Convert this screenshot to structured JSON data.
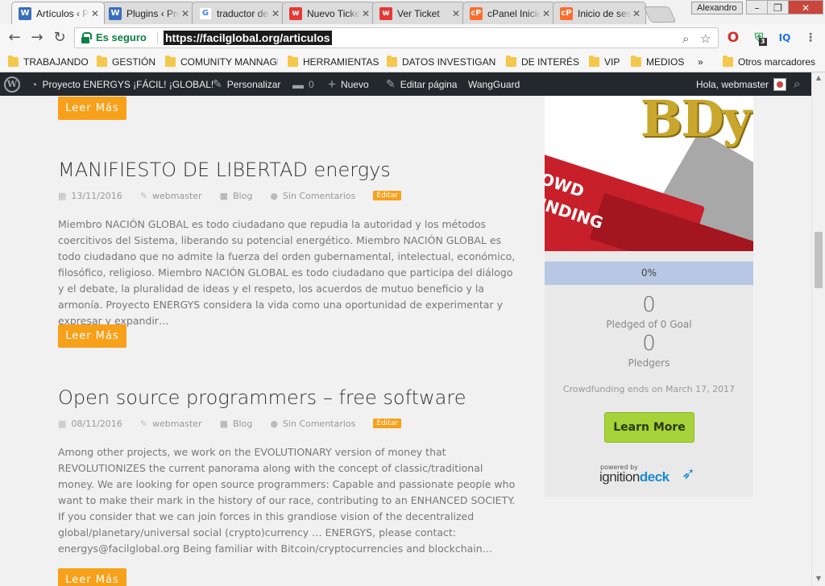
{
  "browser": {
    "tabs": [
      {
        "title": "Artículos ‹ Proyecto ENERGYS",
        "icon": "wordpress-favicon",
        "color": "#3a6ebd"
      },
      {
        "title": "Plugins ‹ Proyecto",
        "icon": "wordpress-favicon",
        "color": "#3a6ebd"
      },
      {
        "title": "traductor de google",
        "icon": "google-favicon",
        "color": "#4285f4"
      },
      {
        "title": "Nuevo Ticket",
        "icon": "w-favicon",
        "color": "#e53935"
      },
      {
        "title": "Ver Ticket",
        "icon": "w-favicon",
        "color": "#e53935"
      },
      {
        "title": "cPanel Inicio",
        "icon": "cpanel-favicon",
        "color": "#ff6c2c"
      },
      {
        "title": "Inicio de sesión",
        "icon": "cpanel-favicon",
        "color": "#ff6c2c"
      }
    ],
    "profile": "Alexandro",
    "secure_label": "Es seguro",
    "url": "https://facilglobal.org/articulos",
    "extension_badge": "3",
    "extension_iq": "IQ"
  },
  "bookmarks": {
    "items": [
      "TRABAJANDO",
      "GESTIÓN",
      "COMUNITY MANNAGER",
      "HERRAMIENTAS",
      "DATOS INVESTIGANDO",
      "DE INTERÉS",
      "VIP",
      "MEDIOS"
    ],
    "overflow": "»",
    "other": "Otros marcadores"
  },
  "adminbar": {
    "site_name": "Proyecto ENERGYS ¡FÁCIL! ¡GLOBAL!",
    "customize": "Personalizar",
    "comments_count": "0",
    "new": "Nuevo",
    "edit_page": "Editar página",
    "wangguard": "WangGuard",
    "greeting": "Hola, webmaster"
  },
  "posts": [
    {
      "title": "MANIFIESTO DE LIBERTAD energys",
      "date": "13/11/2016",
      "author": "webmaster",
      "category": "Blog",
      "comments": "Sin Comentarios",
      "edit": "Editar",
      "excerpt": "Miembro NACIÓN GLOBAL es todo ciudadano que repudia la autoridad y los métodos coercitivos del Sistema, liberando su potencial energético. Miembro NACIÓN GLOBAL es todo ciudadano que no admite la fuerza del orden gubernamental, intelectual, económico, filosófico, religioso. Miembro NACIÓN GLOBAL es todo ciudadano que participa del diálogo y el debate, la pluralidad de ideas y el respeto, los acuerdos de mutuo beneficio y la armonía. Proyecto ENERGYS considera la vida como una oportunidad de experimentar y expresar y expandir…",
      "read_more": "Leer Más"
    },
    {
      "title": "Open source programmers – free software",
      "date": "08/11/2016",
      "author": "webmaster",
      "category": "Blog",
      "comments": "Sin Comentarios",
      "edit": "Editar",
      "excerpt": "Among other projects, we work on the EVOLUTIONARY version of money that REVOLUTIONIZES the current panorama along with the concept of classic/traditional money. We are looking for open source programmers: Capable and passionate people who want to make their mark in the history of our race, contributing to an ENHANCED SOCIETY. If you consider that we can join forces in this grandiose vision of the decentralized global/planetary/universal social (crypto)currency … ENERGYS, please contact: energys@facilglobal.org Being familiar with Bitcoin/cryptocurrencies and blockchain…",
      "read_more": "Leer Más"
    }
  ],
  "top_read_more": "Leer Más",
  "widget": {
    "image_text_top": "BDy",
    "image_text_banner": "OWD\nUNDING",
    "progress_label": "0%",
    "progress_fraction": 0,
    "pledged": "0",
    "pledged_label": "Pledged of 0 Goal",
    "pledgers": "0",
    "pledgers_label": "Pledgers",
    "ends": "Crowdfunding ends on March 17, 2017",
    "button": "Learn More",
    "powered_by": "powered by",
    "brand_prefix": "ignition",
    "brand_suffix": "deck"
  },
  "colors": {
    "accent_orange": "#f7a01a",
    "progress_blue": "#7a9ed6",
    "learn_green": "#a6d23a",
    "admin_bar": "#23282d",
    "secure_green": "#0b8043"
  }
}
